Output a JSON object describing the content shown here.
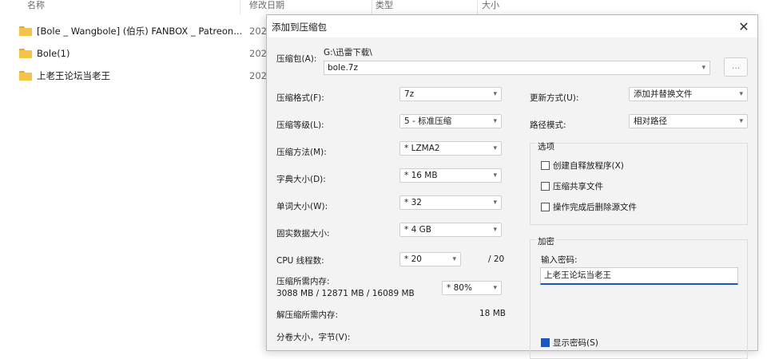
{
  "explorer": {
    "columns": {
      "name": "名称",
      "date": "修改日期",
      "type": "类型",
      "size": "大小"
    },
    "files": [
      {
        "name": "[Bole _ Wangbole] (伯乐) FANBOX _ Patreon...",
        "date": "202"
      },
      {
        "name": "Bole(1)",
        "date": "202"
      },
      {
        "name": "上老王论坛当老王",
        "date": "202"
      }
    ]
  },
  "dialog": {
    "title": "添加到压缩包",
    "close_icon": "close-icon",
    "archive": {
      "label": "压缩包(A):",
      "folder_path": "G:\\迅雷下载\\",
      "filename": "bole.7z",
      "browse_label": "..."
    },
    "left": {
      "format": {
        "label": "压缩格式(F):",
        "value": "7z"
      },
      "level": {
        "label": "压缩等级(L):",
        "value": "5 - 标准压缩"
      },
      "method": {
        "label": "压缩方法(M):",
        "value": "* LZMA2"
      },
      "dict": {
        "label": "字典大小(D):",
        "value": "* 16 MB"
      },
      "word": {
        "label": "单词大小(W):",
        "value": "* 32"
      },
      "solid": {
        "label": "固实数据大小:",
        "value": "* 4 GB"
      },
      "cpu": {
        "label": "CPU 线程数:",
        "value": "* 20",
        "total": "/ 20"
      },
      "memory": {
        "label": "压缩所需内存:",
        "detail": "3088 MB / 12871 MB / 16089 MB",
        "value": "* 80%"
      },
      "decompress": {
        "label": "解压缩所需内存:",
        "value": "18 MB"
      },
      "split": {
        "label": "分卷大小，字节(V):"
      }
    },
    "right": {
      "update": {
        "label": "更新方式(U):",
        "value": "添加并替换文件"
      },
      "pathmode": {
        "label": "路径模式:",
        "value": "相对路径"
      },
      "options": {
        "title": "选项",
        "items": [
          {
            "label": "创建自释放程序(X)",
            "checked": false
          },
          {
            "label": "压缩共享文件",
            "checked": false
          },
          {
            "label": "操作完成后删除源文件",
            "checked": false
          }
        ]
      },
      "encryption": {
        "title": "加密",
        "password_label": "输入密码:",
        "password_value": "上老王论坛当老王",
        "show_password": {
          "label": "显示密码(S)",
          "checked": true
        }
      }
    }
  },
  "colors": {
    "accent": "#1a56c4",
    "folder": "#f4c447"
  }
}
